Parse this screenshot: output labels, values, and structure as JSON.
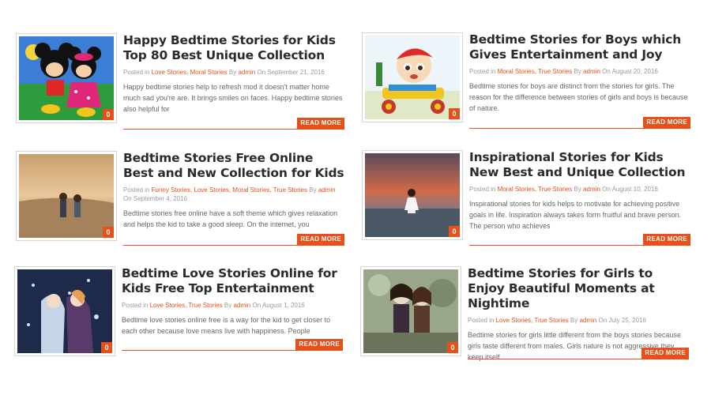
{
  "posts": [
    {
      "title": "Happy Bedtime Stories for Kids Top 80 Best Unique Collection",
      "posted_in": "Posted in",
      "categories": "Love Stories, Moral Stories",
      "by": "By",
      "author": "admin",
      "on": "On September 21, 2016",
      "excerpt": "Happy bedtime stories help to refresh mod it doesn't matter home much sad you're are. It brings smiles on faces. Happy bedtime stories also helpful for",
      "comments": "0",
      "read_more": "READ MORE",
      "thumb_icon": "mickey-minnie-image"
    },
    {
      "title": "Bedtime Stories for Boys which Gives Entertainment and Joy",
      "posted_in": "Posted in",
      "categories": "Moral Stories, True Stories",
      "by": "By",
      "author": "admin",
      "on": "On August 20, 2016",
      "excerpt": "Bedtime stories for boys are distinct from the stories for girls. The reason for the difference between stories of girls and boys is because of nature.",
      "comments": "0",
      "read_more": "READ MORE",
      "thumb_icon": "cartoon-boy-image"
    },
    {
      "title": "Bedtime Stories Free Online Best and New Collection for Kids",
      "posted_in": "Posted in",
      "categories": "Funny Stories, Love Stories, Moral Stories, True Stories",
      "by": "By",
      "author": "admin",
      "on": "On September 4, 2016",
      "excerpt": "Bedtime stories free online have a soft theme which gives relaxation and helps the kid to take a good sleep. On the internet, you",
      "comments": "0",
      "read_more": "READ MORE",
      "thumb_icon": "kids-walking-image"
    },
    {
      "title": "Inspirational Stories for Kids New Best and Unique Collection",
      "posted_in": "Posted in",
      "categories": "Moral Stories, True Stories",
      "by": "By",
      "author": "admin",
      "on": "On August 10, 2016",
      "excerpt": "Inspirational stories for kids helps to motivate for achieving positive goals in life. Inspiration always takes form fruitful and brave person. The person who achieves",
      "comments": "0",
      "read_more": "READ MORE",
      "thumb_icon": "girl-sunset-image"
    },
    {
      "title": "Bedtime Love Stories Online for Kids Free Top Entertainment",
      "posted_in": "Posted in",
      "categories": "Love Stories, True Stories",
      "by": "By",
      "author": "admin",
      "on": "On August 1, 2016",
      "excerpt": "Bedtime love stories online free is a way for the kid to get closer to each other because love means live with happiness. People",
      "comments": "0",
      "read_more": "READ MORE",
      "thumb_icon": "anime-couple-image"
    },
    {
      "title": "Bedtime Stories for Girls to Enjoy Beautiful Moments at Nightime",
      "posted_in": "Posted in",
      "categories": "Love Stories, True Stories",
      "by": "By",
      "author": "admin",
      "on": "On July 25, 2016",
      "excerpt": "Bedtime stories for girls little different from the boys stories because girls taste different from males. Girls nature is not aggressive they keep itself",
      "comments": "0",
      "read_more": "READ MORE",
      "thumb_icon": "dolls-image"
    }
  ],
  "colors": {
    "accent": "#e8501a",
    "title": "#2b2b2b",
    "meta": "#999999"
  }
}
